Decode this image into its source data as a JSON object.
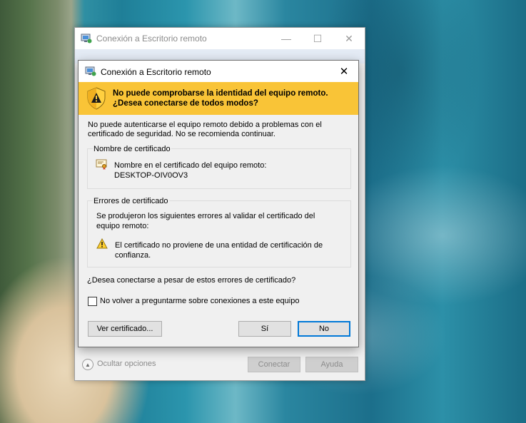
{
  "main_window": {
    "title": "Conexión a Escritorio remoto",
    "hide_options": "Ocultar opciones",
    "connect_button": "Conectar",
    "help_button": "Ayuda"
  },
  "dialog": {
    "title": "Conexión a Escritorio remoto",
    "warning_title": "No puede comprobarse la identidad del equipo remoto. ¿Desea conectarse de todos modos?",
    "warning_line1": "No puede comprobarse la identidad del equipo remoto.",
    "warning_line2": "¿Desea conectarse de todos modos?",
    "intro": "No puede autenticarse el equipo remoto debido a problemas con el certificado de seguridad. No se recomienda continuar.",
    "certificate_name": {
      "heading": "Nombre de certificado",
      "label": "Nombre en el certificado del equipo remoto:",
      "value": "DESKTOP-OIV0OV3"
    },
    "certificate_errors": {
      "heading": "Errores de certificado",
      "description": "Se produjeron los siguientes errores al validar el certificado del equipo remoto:",
      "error_item": "El certificado no proviene de una entidad de certificación de confianza."
    },
    "question": "¿Desea conectarse a pesar de estos errores de certificado?",
    "dont_ask_checkbox": {
      "label": "No volver a preguntarme sobre conexiones a este equipo",
      "checked": false
    },
    "view_certificate_button": "Ver certificado...",
    "yes_button": "Sí",
    "no_button": "No"
  },
  "icons": {
    "app": "remote-desktop-icon",
    "shield": "shield-warning-icon",
    "certificate": "certificate-icon",
    "warning": "warning-triangle-icon"
  },
  "colors": {
    "warning_banner": "#f9c437",
    "default_button_border": "#0078d7"
  }
}
